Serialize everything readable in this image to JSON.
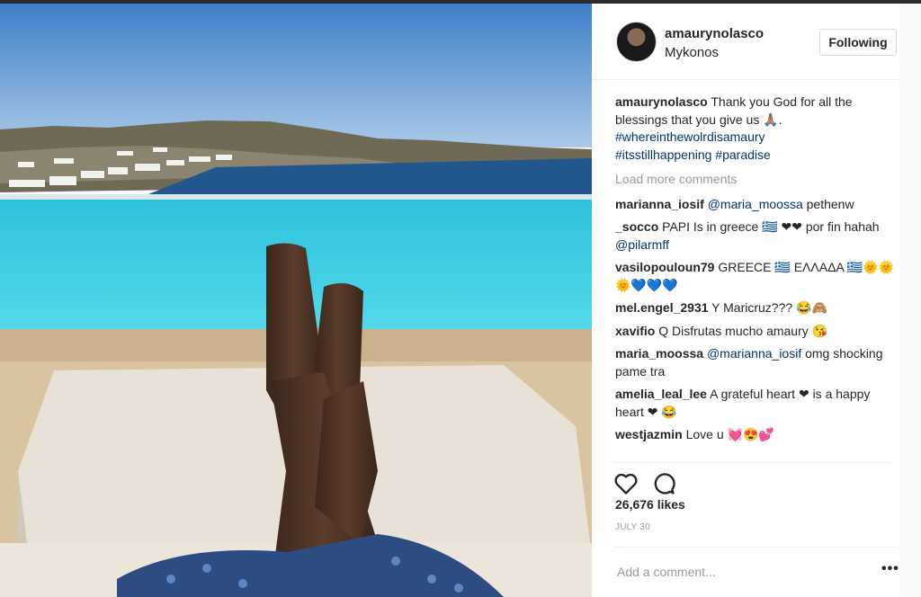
{
  "post": {
    "username": "amaurynolasco",
    "location": "Mykonos",
    "follow_label": "Following",
    "caption": {
      "username": "amaurynolasco",
      "text": "Thank you God for all the blessings that you give us 🙏🏽.",
      "tags": [
        "#whereinthewolrdisamaury",
        "#itsstillhappening",
        "#paradise"
      ]
    },
    "load_more_label": "Load more comments",
    "comments": [
      {
        "user": "marianna_iosif",
        "mention": "@maria_moossa",
        "text": "pethenw"
      },
      {
        "user": "_socco",
        "text": "PAPI Is in greece 🇬🇷 ❤❤ por fin hahah",
        "mention_after": "@pilarmff"
      },
      {
        "user": "vasilopouloun79",
        "text": "GREECE 🇬🇷 ΕΛΛΑΔΑ 🇬🇷🌞🌞🌞💙💙💙"
      },
      {
        "user": "mel.engel_2931",
        "text": "Y Maricruz??? 😂🙈"
      },
      {
        "user": "xavifio",
        "text": "Q Disfrutas mucho amaury 😘"
      },
      {
        "user": "maria_moossa",
        "mention": "@marianna_iosif",
        "text": "omg shocking pame tra"
      },
      {
        "user": "amelia_leal_lee",
        "text": "A grateful heart ❤ is a happy heart ❤ 😂"
      },
      {
        "user": "westjazmin",
        "text": "Love u 💓😍💕"
      }
    ],
    "likes": "26,676 likes",
    "date": "JULY 30",
    "comment_placeholder": "Add a comment...",
    "more_options": "•••",
    "icons": {
      "like": "heart-icon",
      "comment": "speech-bubble-icon",
      "more": "ellipsis-icon"
    }
  }
}
